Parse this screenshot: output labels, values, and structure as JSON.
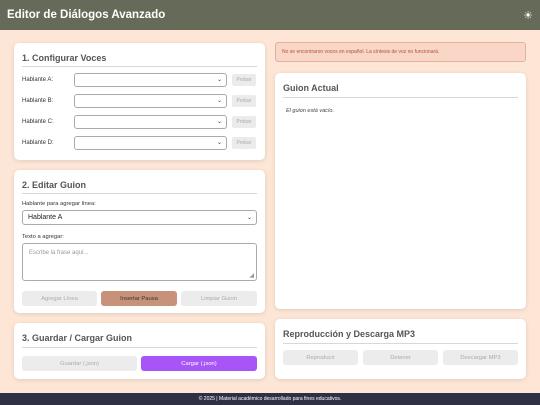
{
  "header": {
    "title": "Editor de Diálogos Avanzado",
    "theme_icon": "☀"
  },
  "voices": {
    "title": "1. Configurar Voces",
    "test_label": "Probar",
    "speakers": [
      {
        "label": "Hablante A:",
        "value": ""
      },
      {
        "label": "Hablante B:",
        "value": ""
      },
      {
        "label": "Hablante C:",
        "value": ""
      },
      {
        "label": "Hablante D:",
        "value": ""
      }
    ]
  },
  "editor": {
    "title": "2. Editar Guion",
    "speaker_label": "Hablante para agregar línea:",
    "speaker_value": "Hablante A",
    "text_label": "Texto a agregar:",
    "text_placeholder": "Escribe la frase aquí...",
    "add_line": "Agregar Línea",
    "insert_pause": "Insertar Pausa",
    "clear_script": "Limpiar Guion"
  },
  "saveload": {
    "title": "3. Guardar / Cargar Guion",
    "save": "Guardar (.json)",
    "load": "Cargar (.json)"
  },
  "alert": {
    "text": "No se encontraron voces en español. La síntesis de voz no funcionará."
  },
  "script": {
    "title": "Guion Actual",
    "empty": "El guion está vacío."
  },
  "playback": {
    "title": "Reproducción y Descarga MP3",
    "play": "Reproducir",
    "stop": "Detener",
    "download": "Descargar MP3"
  },
  "footer": {
    "text": "© 2025 | Material académico desarrollado para fines educativos."
  },
  "colors": {
    "header_bg": "#666b59",
    "page_bg": "#fde6d6",
    "accent": "#c8917a",
    "purple": "#a855f7",
    "alert_text": "#b0533e"
  }
}
